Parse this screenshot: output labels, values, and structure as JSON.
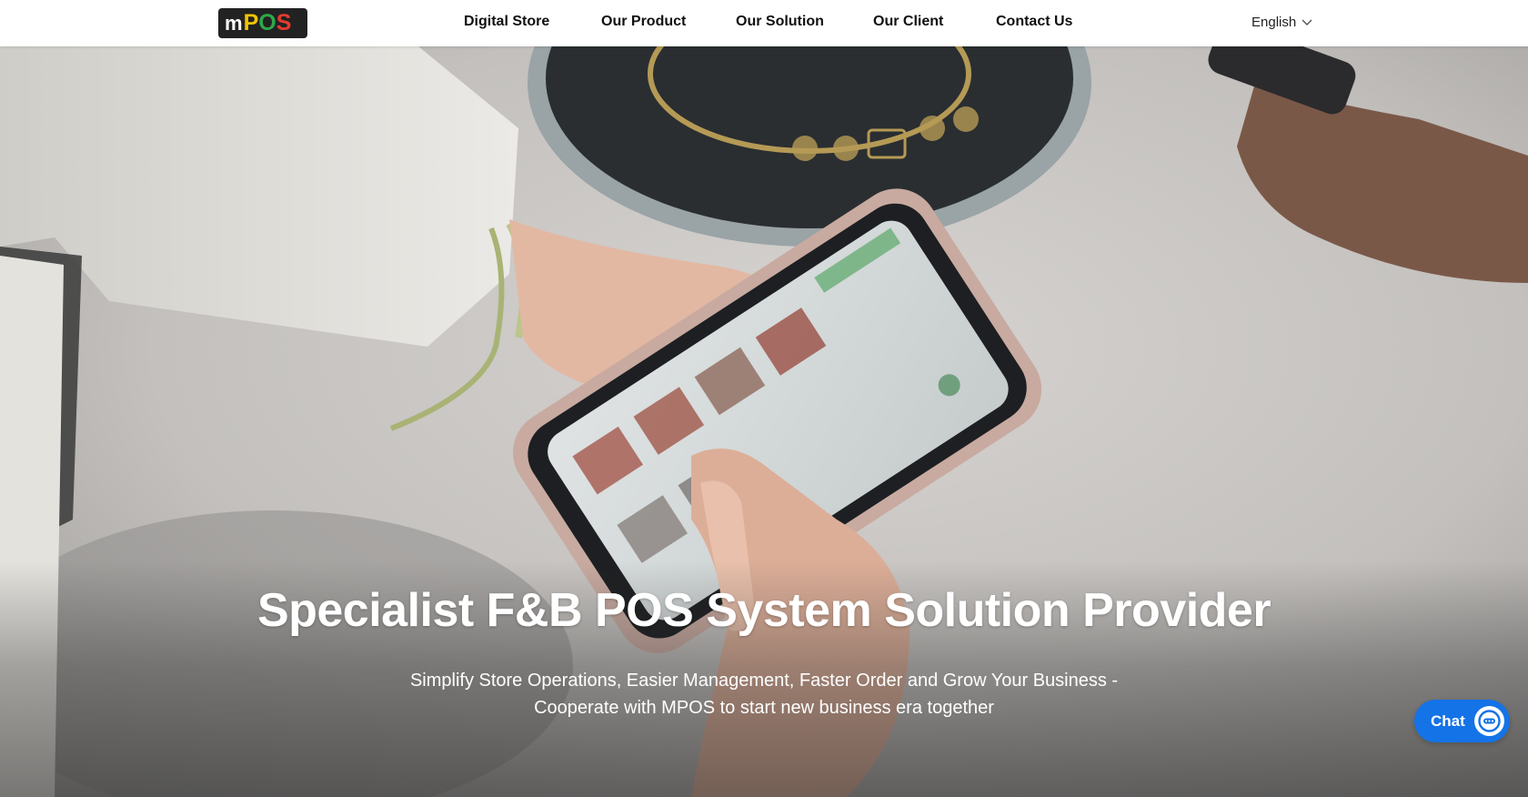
{
  "header": {
    "logo": {
      "letters": [
        "m",
        "P",
        "O",
        "S"
      ],
      "colors": [
        "#ffffff",
        "#f2c300",
        "#2ea84a",
        "#e23b2e"
      ],
      "background": "#222222"
    },
    "nav": [
      {
        "label": "Digital Store"
      },
      {
        "label": "Our Product"
      },
      {
        "label": "Our Solution"
      },
      {
        "label": "Our Client"
      },
      {
        "label": "Contact Us"
      }
    ],
    "language": {
      "selected": "English",
      "icon": "chevron-down-icon"
    }
  },
  "hero": {
    "title": "Specialist F&B POS System Solution Provider",
    "subtitle_line1": "Simplify Store Operations, Easier Management, Faster Order and Grow Your Business -",
    "subtitle_line2": "Cooperate with MPOS to start new business era together"
  },
  "chat": {
    "label": "Chat",
    "icon": "chat-bubble-icon",
    "color": "#1473e6"
  }
}
